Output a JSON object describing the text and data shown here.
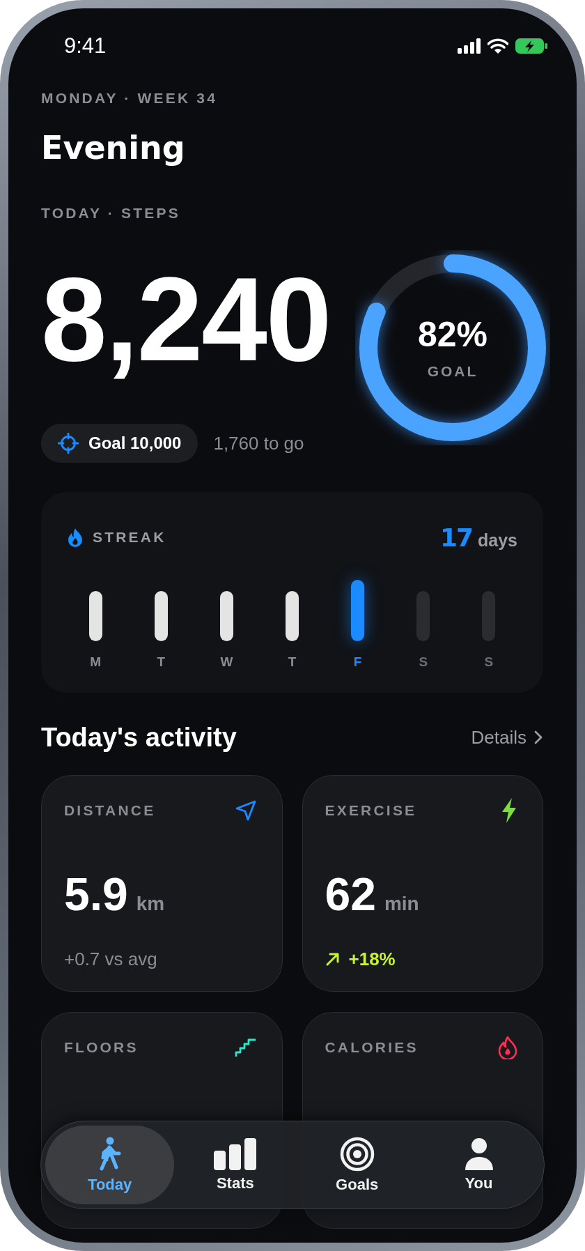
{
  "status_bar": {
    "time": "9:41"
  },
  "header": {
    "date": "MONDAY · WEEK 34",
    "greeting": "Evening"
  },
  "steps": {
    "label": "TODAY · STEPS",
    "count": "8,240",
    "goal": "Goal 10,000",
    "remaining": "1,760 to go",
    "ring": {
      "level": 0.82,
      "percent": "82%",
      "caption": "GOAL"
    }
  },
  "streak": {
    "title": "STREAK",
    "count": "17",
    "unit": "days",
    "days": [
      {
        "label": "M",
        "done": true,
        "selected": false
      },
      {
        "label": "T",
        "done": true,
        "selected": false
      },
      {
        "label": "W",
        "done": true,
        "selected": false
      },
      {
        "label": "T",
        "done": true,
        "selected": false
      },
      {
        "label": "F",
        "done": false,
        "selected": true
      },
      {
        "label": "S",
        "done": false,
        "selected": false
      },
      {
        "label": "S",
        "done": false,
        "selected": false
      }
    ]
  },
  "activity": {
    "title": "Today's activity",
    "link": "Details",
    "cards": [
      {
        "kind": "distance",
        "label": "DISTANCE",
        "value": "5.9",
        "unit": "km",
        "note": "+0.7 vs avg",
        "color": "#1a8cff"
      },
      {
        "kind": "exercise",
        "label": "EXERCISE",
        "value": "62",
        "unit": "min",
        "note": "+18%",
        "rising": true,
        "color": "#7be03a"
      },
      {
        "kind": "floors",
        "label": "FLOORS",
        "color": "#2ee6c8"
      },
      {
        "kind": "calories",
        "label": "CALORIES",
        "color": "#ff2d55"
      }
    ]
  },
  "tab_bar": [
    {
      "kind": "walk",
      "label": "Today",
      "selected": true
    },
    {
      "kind": "bars",
      "label": "Stats",
      "selected": false
    },
    {
      "kind": "target",
      "label": "Goals",
      "selected": false
    },
    {
      "kind": "person",
      "label": "You",
      "selected": false
    }
  ]
}
